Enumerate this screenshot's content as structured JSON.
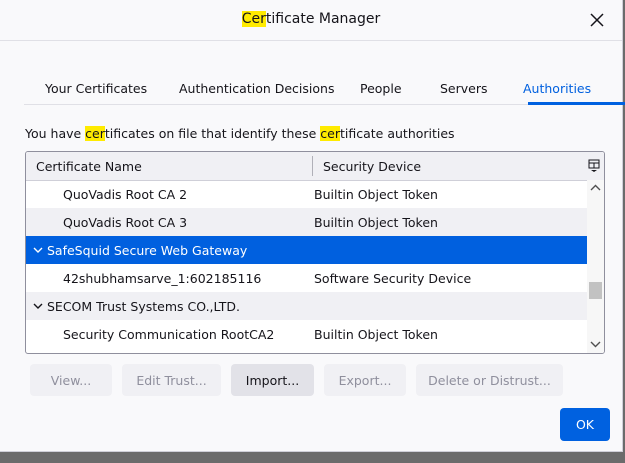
{
  "window": {
    "title_highlight": "Cer",
    "title_rest": "tificate Manager"
  },
  "tabs": [
    {
      "label": "Your Certificates",
      "active": false
    },
    {
      "label": "Authentication Decisions",
      "active": false
    },
    {
      "label": "People",
      "active": false
    },
    {
      "label": "Servers",
      "active": false
    },
    {
      "label": "Authorities",
      "active": true
    }
  ],
  "description": {
    "part1": "You have ",
    "hl1": "cer",
    "part2": "tificates on file that identify these ",
    "hl2": "cer",
    "part3": "tificate authorities"
  },
  "tree": {
    "columns": [
      "Certificate Name",
      "Security Device"
    ],
    "rows": [
      {
        "type": "cert",
        "name": "QuoVadis Root CA 2",
        "device": "Builtin Object Token"
      },
      {
        "type": "cert",
        "name": "QuoVadis Root CA 3",
        "device": "Builtin Object Token"
      },
      {
        "type": "group",
        "name": "SafeSquid Secure Web Gateway",
        "device": "",
        "selected": true
      },
      {
        "type": "cert",
        "name": "42shubhamsarve_1:602185116",
        "device": "Software Security Device"
      },
      {
        "type": "group",
        "name": "SECOM Trust Systems CO.,LTD.",
        "device": ""
      },
      {
        "type": "cert",
        "name": "Security Communication RootCA2",
        "device": "Builtin Object Token"
      }
    ]
  },
  "buttons": {
    "view": "View...",
    "edit_trust": "Edit Trust...",
    "import": "Import...",
    "export": "Export...",
    "delete": "Delete or Distrust...",
    "ok": "OK"
  },
  "colors": {
    "accent": "#0061e0",
    "selection": "#0060df",
    "find_highlight": "#ffeb00"
  }
}
